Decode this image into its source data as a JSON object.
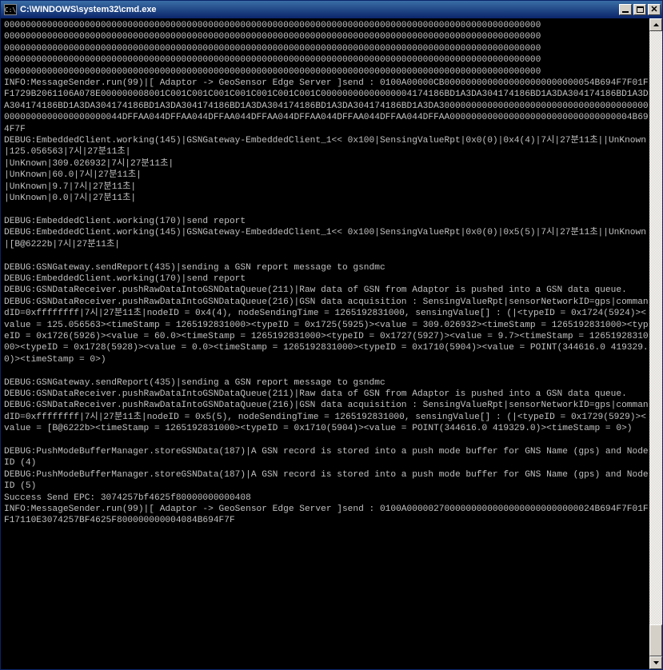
{
  "window": {
    "icon_label": "C:\\",
    "title": "C:\\WINDOWS\\system32\\cmd.exe"
  },
  "console": {
    "lines": [
      "0000000000000000000000000000000000000000000000000000000000000000000000000000000000000000000000000000",
      "0000000000000000000000000000000000000000000000000000000000000000000000000000000000000000000000000000",
      "0000000000000000000000000000000000000000000000000000000000000000000000000000000000000000000000000000",
      "0000000000000000000000000000000000000000000000000000000000000000000000000000000000000000000000000000",
      "0000000000000000000000000000000000000000000000000000000000000000000000000000000000000000000000000000",
      "INFO:MessageSender.run(99)|[ Adaptor -> GeoSensor Edge Server ]send : 0100A00000CB0000000000000000000000000054B694F7F01FF1729B2061106A078E000000008001C001C001C001C001C001C001C001C00000000000000004174186BD1A3DA304174186BD1A3DA304174186BD1A3DA304174186BD1A3DA304174186BD1A3DA304174186BD1A3DA304174186BD1A3DA304174186BD1A3DA3000000000000000000000000000000000000000000000000000000000044DFFAA044DFFAA044DFFAA044DFFAA044DFFAA044DFFAA044DFFAA044DFFAA0000000000000000000000000000000004B694F7F",
      "DEBUG:EmbeddedClient.working(145)|GSNGateway-EmbeddedClient_1<< 0x100|SensingValueRpt|0x0(0)|0x4(4)|7시|27분11초||UnKnown|125.056563|7시|27분11초|",
      "|UnKnown|309.026932|7시|27분11초|",
      "|UnKnown|60.0|7시|27분11초|",
      "|UnKnown|9.7|7시|27분11초|",
      "|UnKnown|0.0|7시|27분11초|",
      "",
      "DEBUG:EmbeddedClient.working(170)|send report",
      "DEBUG:EmbeddedClient.working(145)|GSNGateway-EmbeddedClient_1<< 0x100|SensingValueRpt|0x0(0)|0x5(5)|7시|27분11초||UnKnown|[B@6222b|7시|27분11초|",
      "",
      "DEBUG:GSNGateway.sendReport(435)|sending a GSN report message to gsndmc",
      "DEBUG:EmbeddedClient.working(170)|send report",
      "DEBUG:GSNDataReceiver.pushRawDataIntoGSNDataQueue(211)|Raw data of GSN from Adaptor is pushed into a GSN data queue.",
      "DEBUG:GSNDataReceiver.pushRawDataIntoGSNDataQueue(216)|GSN data acquisition : SensingValueRpt|sensorNetworkID=gps|commandID=0xffffffff|7시|27분11초|nodeID = 0x4(4), nodeSendingTime = 1265192831000, sensingValue[] : (|<typeID = 0x1724(5924)><value = 125.056563><timeStamp = 1265192831000><typeID = 0x1725(5925)><value = 309.026932><timeStamp = 1265192831000><typeID = 0x1726(5926)><value = 60.0><timeStamp = 1265192831000><typeID = 0x1727(5927)><value = 9.7><timeStamp = 1265192831000><typeID = 0x1728(5928)><value = 0.0><timeStamp = 1265192831000><typeID = 0x1710(5904)><value = POINT(344616.0 419329.0)><timeStamp = 0>)",
      "",
      "DEBUG:GSNGateway.sendReport(435)|sending a GSN report message to gsndmc",
      "DEBUG:GSNDataReceiver.pushRawDataIntoGSNDataQueue(211)|Raw data of GSN from Adaptor is pushed into a GSN data queue.",
      "DEBUG:GSNDataReceiver.pushRawDataIntoGSNDataQueue(216)|GSN data acquisition : SensingValueRpt|sensorNetworkID=gps|commandID=0xffffffff|7시|27분11초|nodeID = 0x5(5), nodeSendingTime = 1265192831000, sensingValue[] : (|<typeID = 0x1729(5929)><value = [B@6222b><timeStamp = 1265192831000><typeID = 0x1710(5904)><value = POINT(344616.0 419329.0)><timeStamp = 0>)",
      "",
      "DEBUG:PushModeBufferManager.storeGSNData(187)|A GSN record is stored into a push mode buffer for GNS Name (gps) and Node ID (4)",
      "DEBUG:PushModeBufferManager.storeGSNData(187)|A GSN record is stored into a push mode buffer for GNS Name (gps) and Node ID (5)",
      "Success Send EPC: 3074257bf4625f80000000000408",
      "INFO:MessageSender.run(99)|[ Adaptor -> GeoSensor Edge Server ]send : 0100A00000270000000000000000000000000024B694F7F01FF17110E3074257BF4625F800000000004084B694F7F"
    ]
  }
}
